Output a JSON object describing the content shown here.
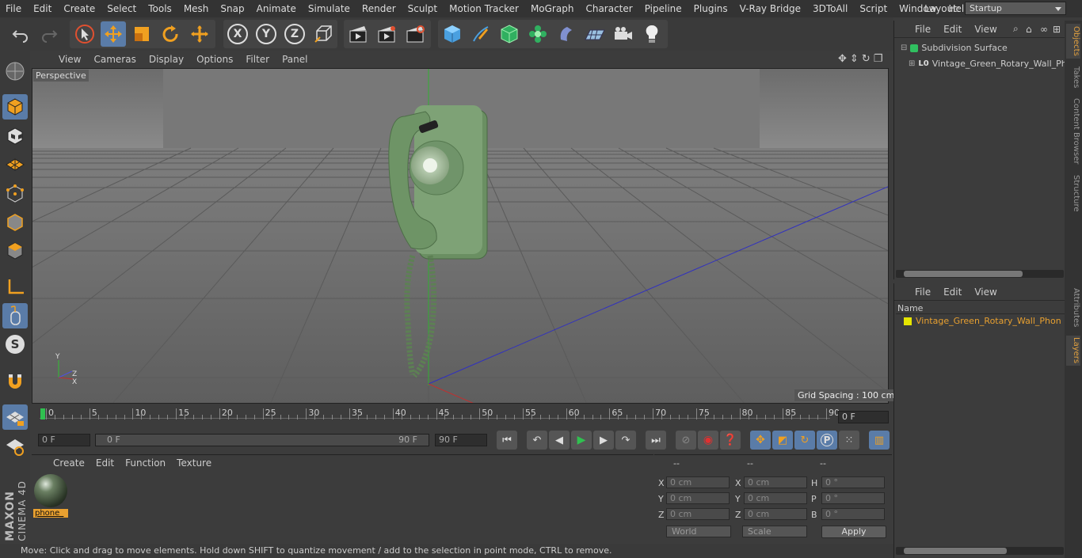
{
  "menu": [
    "File",
    "Edit",
    "Create",
    "Select",
    "Tools",
    "Mesh",
    "Snap",
    "Animate",
    "Simulate",
    "Render",
    "Sculpt",
    "Motion Tracker",
    "MoGraph",
    "Character",
    "Pipeline",
    "Plugins",
    "V-Ray Bridge",
    "3DToAll",
    "Script",
    "Window",
    "Help"
  ],
  "layout": {
    "label": "Layout:",
    "value": "Startup"
  },
  "toolbar_axes": [
    "X",
    "Y",
    "Z"
  ],
  "viewport": {
    "menu": [
      "View",
      "Cameras",
      "Display",
      "Options",
      "Filter",
      "Panel"
    ],
    "label": "Perspective",
    "grid_spacing": "Grid Spacing : 100 cm",
    "axis_labels": {
      "y": "Y",
      "z": "Z",
      "x": "X"
    }
  },
  "timeline": {
    "ticks": [
      "0",
      "5",
      "10",
      "15",
      "20",
      "25",
      "30",
      "35",
      "40",
      "45",
      "50",
      "55",
      "60",
      "65",
      "70",
      "75",
      "80",
      "85",
      "90"
    ],
    "current_frame": "0 F",
    "start_field": "0 F",
    "range_start": "0 F",
    "range_end": "90 F",
    "end_field": "90 F"
  },
  "material": {
    "menu": [
      "Create",
      "Edit",
      "Function",
      "Texture"
    ],
    "name": "phone_"
  },
  "coords": {
    "headers": [
      "--",
      "--",
      "--"
    ],
    "labels": [
      "X",
      "Y",
      "Z",
      "X",
      "Y",
      "Z",
      "H",
      "P",
      "B"
    ],
    "values": [
      "0 cm",
      "0 cm",
      "0 cm",
      "0 cm",
      "0 cm",
      "0 cm",
      "0 °",
      "0 °",
      "0 °"
    ],
    "world": "World",
    "scale": "Scale",
    "apply": "Apply"
  },
  "objects": {
    "menu": [
      "File",
      "Edit",
      "View"
    ],
    "items": [
      "Subdivision Surface",
      "Vintage_Green_Rotary_Wall_Pho"
    ]
  },
  "layers": {
    "menu": [
      "File",
      "Edit",
      "View"
    ],
    "header": "Name",
    "items": [
      "Vintage_Green_Rotary_Wall_Phon"
    ]
  },
  "right_tabs": [
    "Objects",
    "Takes",
    "Content Browser",
    "Structure",
    "Attributes",
    "Layers"
  ],
  "brand": {
    "maxon": "MAXON",
    "cinema": "CINEMA 4D"
  },
  "status": "Move: Click and drag to move elements. Hold down SHIFT to quantize movement / add to the selection in point mode, CTRL to remove.",
  "colors": {
    "accent": "#5a7ca8",
    "selected_text": "#e8a030",
    "layer_color": "#e6e600"
  }
}
